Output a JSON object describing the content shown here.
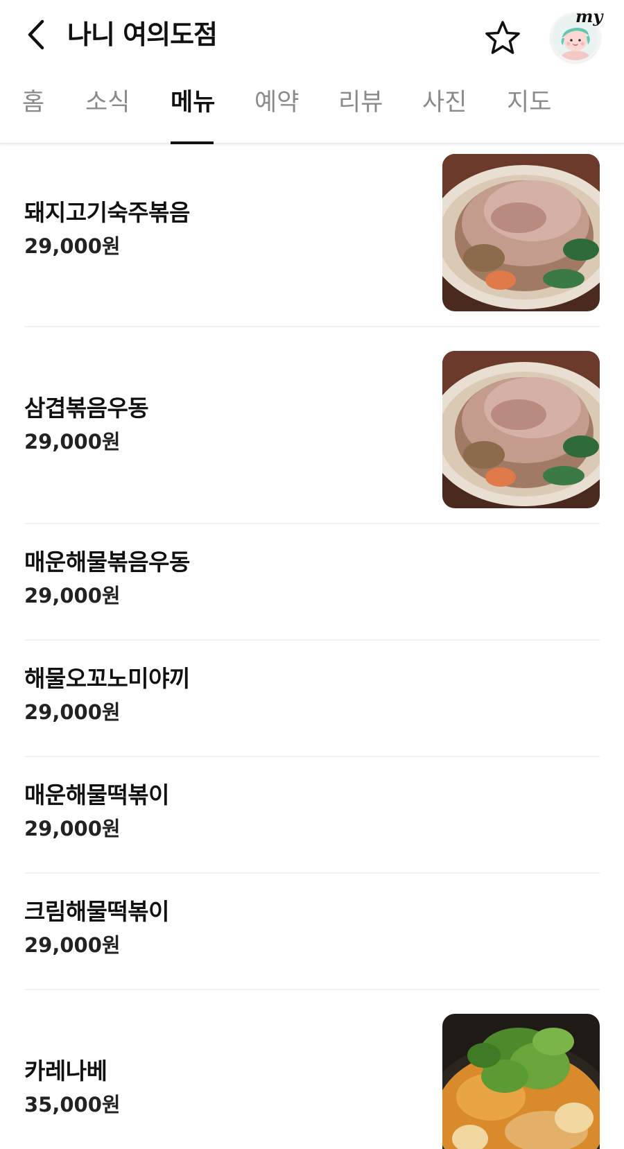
{
  "header": {
    "title": "나니 여의도점",
    "back_icon": "chevron-left-icon",
    "favorite_icon": "star-outline-icon",
    "my_badge_text": "my"
  },
  "tabs": [
    {
      "label": "홈",
      "active": false
    },
    {
      "label": "소식",
      "active": false
    },
    {
      "label": "메뉴",
      "active": true
    },
    {
      "label": "예약",
      "active": false
    },
    {
      "label": "리뷰",
      "active": false
    },
    {
      "label": "사진",
      "active": false
    },
    {
      "label": "지도",
      "active": false
    }
  ],
  "menu": [
    {
      "name": "돼지고기숙주볶음",
      "price": "29,000원",
      "has_photo": true
    },
    {
      "name": "삼겹볶음우동",
      "price": "29,000원",
      "has_photo": true
    },
    {
      "name": "매운해물볶음우동",
      "price": "29,000원",
      "has_photo": false
    },
    {
      "name": "해물오꼬노미야끼",
      "price": "29,000원",
      "has_photo": false
    },
    {
      "name": "매운해물떡볶이",
      "price": "29,000원",
      "has_photo": false
    },
    {
      "name": "크림해물떡볶이",
      "price": "29,000원",
      "has_photo": false
    },
    {
      "name": "카레나베",
      "price": "35,000원",
      "has_photo": true
    }
  ],
  "colors": {
    "active_tab": "#111111",
    "inactive_tab": "#8a8a8a",
    "divider": "#f0f0f0"
  }
}
